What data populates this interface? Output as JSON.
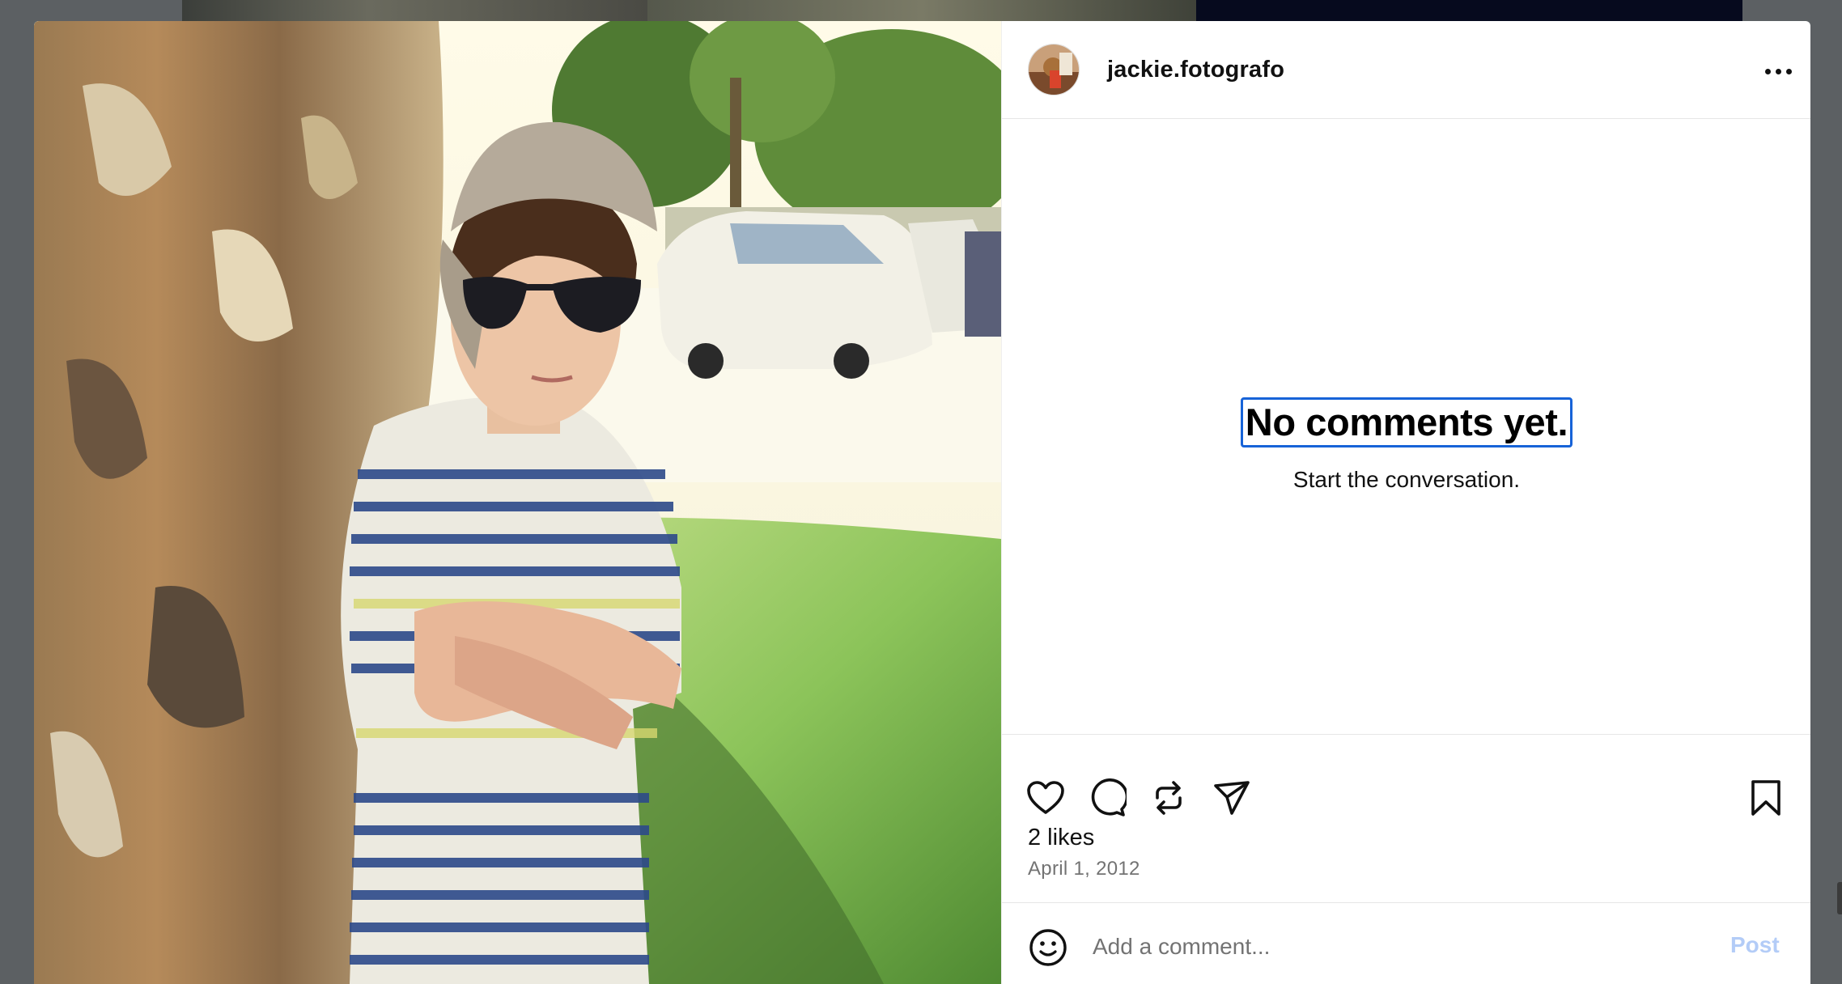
{
  "post": {
    "username": "jackie.fotografo",
    "more_label": "More options",
    "likes": "2 likes",
    "date": "April 1, 2012"
  },
  "comments": {
    "empty_title": "No comments yet.",
    "empty_subtitle": "Start the conversation."
  },
  "actions": {
    "icons": [
      "heart-icon",
      "comment-icon",
      "repost-icon",
      "share-icon",
      "bookmark-icon"
    ]
  },
  "comment_box": {
    "placeholder": "Add a comment...",
    "post_label": "Post"
  },
  "colors": {
    "accent_focus": "#1763d8",
    "post_disabled": "#b3ccf7",
    "secondary_text": "#737373"
  }
}
